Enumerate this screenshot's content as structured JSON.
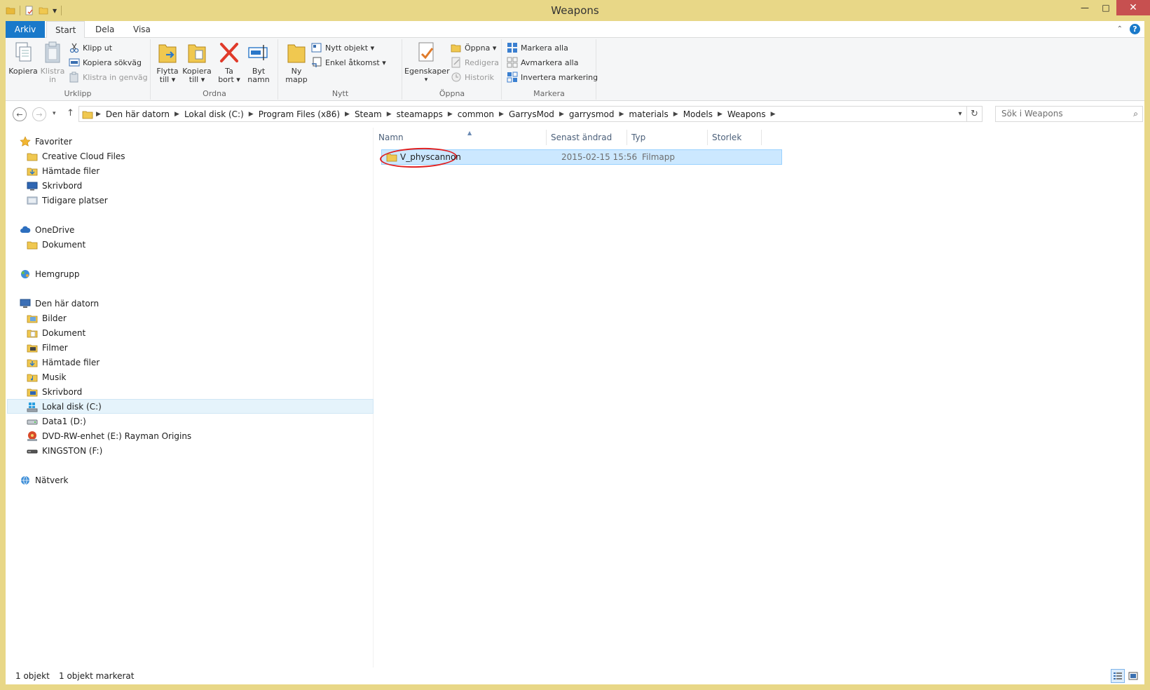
{
  "window": {
    "title": "Weapons",
    "close_glyph": "✕",
    "maximize_glyph": "□",
    "minimize_glyph": "—"
  },
  "ribbon_tabs": [
    "Arkiv",
    "Start",
    "Dela",
    "Visa"
  ],
  "ribbon": {
    "urklipp": {
      "label": "Urklipp",
      "kopiera": "Kopiera",
      "klistra_in_1": "Klistra",
      "klistra_in_2": "in",
      "klipp_ut": "Klipp ut",
      "kopiera_sokvag": "Kopiera sökväg",
      "klistra_in_genvag": "Klistra in genväg"
    },
    "ordna": {
      "label": "Ordna",
      "flytta_1": "Flytta",
      "flytta_2": "till ▾",
      "kopiera_1": "Kopiera",
      "kopiera_2": "till ▾",
      "ta_bort_1": "Ta",
      "ta_bort_2": "bort ▾",
      "byt_namn_1": "Byt",
      "byt_namn_2": "namn"
    },
    "nytt": {
      "label": "Nytt",
      "ny_mapp_1": "Ny",
      "ny_mapp_2": "mapp",
      "nytt_objekt": "Nytt objekt ▾",
      "enkel_atkomst": "Enkel åtkomst ▾"
    },
    "oppna": {
      "label": "Öppna",
      "egenskaper": "Egenskaper",
      "egenskaper_arrow": "▾",
      "oppna": "Öppna ▾",
      "redigera": "Redigera",
      "historik": "Historik"
    },
    "markera": {
      "label": "Markera",
      "markera_alla": "Markera alla",
      "avmarkera_alla": "Avmarkera alla",
      "invertera": "Invertera markering"
    }
  },
  "navigation": {
    "back": "←",
    "forward": "→",
    "recent": "▾",
    "up": "↑",
    "breadcrumbs": [
      "Den här datorn",
      "Lokal disk (C:)",
      "Program Files (x86)",
      "Steam",
      "steamapps",
      "common",
      "GarrysMod",
      "garrysmod",
      "materials",
      "Models",
      "Weapons"
    ],
    "search_placeholder": "Sök i Weapons"
  },
  "nav_pane": {
    "favorites": "Favoriter",
    "fav_items": [
      "Creative Cloud Files",
      "Hämtade filer",
      "Skrivbord",
      "Tidigare platser"
    ],
    "onedrive": "OneDrive",
    "onedrive_items": [
      "Dokument"
    ],
    "homegroup": "Hemgrupp",
    "this_pc": "Den här datorn",
    "pc_items": [
      "Bilder",
      "Dokument",
      "Filmer",
      "Hämtade filer",
      "Musik",
      "Skrivbord",
      "Lokal disk (C:)",
      "Data1 (D:)",
      "DVD-RW-enhet (E:) Rayman Origins",
      "KINGSTON (F:)"
    ],
    "network": "Nätverk",
    "selected": "Lokal disk (C:)"
  },
  "file_list": {
    "columns": [
      "Namn",
      "Senast ändrad",
      "Typ",
      "Storlek"
    ],
    "rows": [
      {
        "name": "V_physcannon",
        "modified": "2015-02-15 15:56",
        "type": "Filmapp",
        "size": ""
      }
    ]
  },
  "status": {
    "count": "1 objekt",
    "selected": "1 objekt markerat"
  },
  "colors": {
    "title_bar": "#e8d787",
    "accent": "#1979ca",
    "selection": "#cce8ff",
    "annotation_circle": "#e02020"
  }
}
